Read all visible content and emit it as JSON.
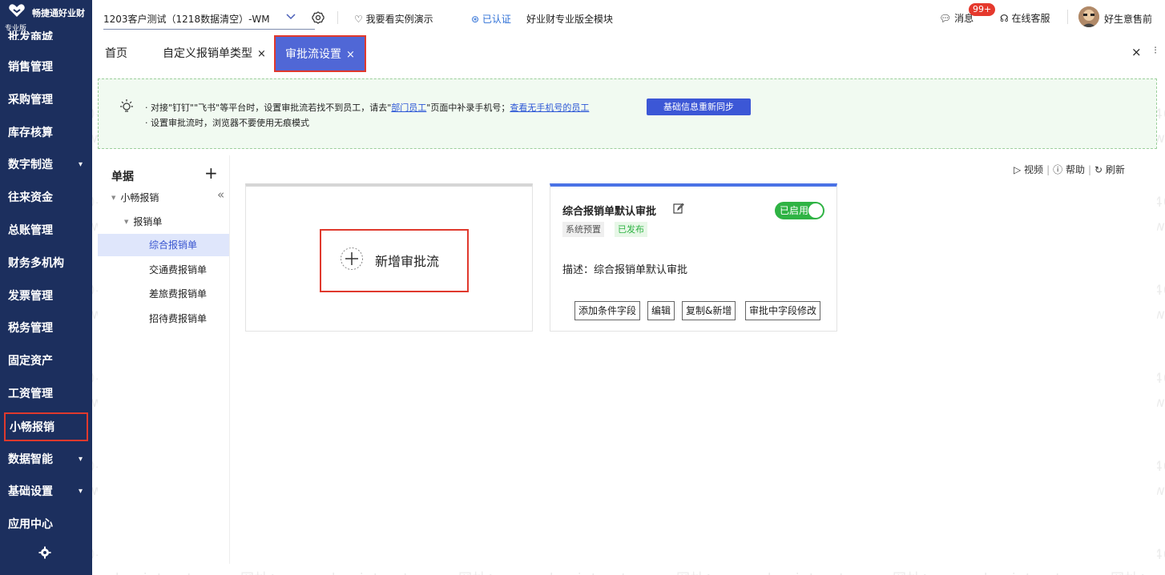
{
  "app": {
    "logo_name": "畅捷通好业财",
    "edition": "专业版",
    "partial_menu_item": "批发商城"
  },
  "sidebar": {
    "items": [
      {
        "label": "销售管理"
      },
      {
        "label": "采购管理"
      },
      {
        "label": "库存核算"
      },
      {
        "label": "数字制造",
        "arrow": "▾"
      },
      {
        "label": "往来资金"
      },
      {
        "label": "总账管理"
      },
      {
        "label": "财务多机构"
      },
      {
        "label": "发票管理"
      },
      {
        "label": "税务管理"
      },
      {
        "label": "固定资产"
      },
      {
        "label": "工资管理"
      },
      {
        "label": "小畅报销",
        "active": true
      },
      {
        "label": "数据智能",
        "arrow": "▾"
      },
      {
        "label": "基础设置",
        "arrow": "▾"
      },
      {
        "label": "应用中心"
      }
    ]
  },
  "header": {
    "company": "1203客户测试（1218数据清空）-WM",
    "demo": "我要看实例演示",
    "verified": "已认证",
    "package": "好业财专业版全模块",
    "messages": "消息",
    "message_badge": "99+",
    "customer_service": "在线客服",
    "user_name": "好生意售前"
  },
  "tabs": [
    {
      "label": "首页",
      "closable": false
    },
    {
      "label": "自定义报销单类型",
      "closable": true
    },
    {
      "label": "审批流设置",
      "closable": true,
      "active": true
    }
  ],
  "tab_close": "×",
  "banner": {
    "tip1_pre": "· 对接\"钉钉\"\"飞书\"等平台时，设置审批流若找不到员工，请去\"",
    "tip1_link": "部门员工",
    "tip1_mid": "\"页面中补录手机号；",
    "tip1_link2": "查看无手机号的员工",
    "sync_button": "基础信息重新同步",
    "tip2": "· 设置审批流时，浏览器不要使用无痕模式"
  },
  "tree": {
    "title": "单据",
    "add": "+",
    "collapse": "«",
    "root": "小畅报销",
    "group": "报销单",
    "leaves": [
      {
        "label": "综合报销单",
        "selected": true
      },
      {
        "label": "交通费报销单"
      },
      {
        "label": "差旅费报销单"
      },
      {
        "label": "招待费报销单"
      }
    ]
  },
  "toolbar": {
    "video": "视频",
    "help": "帮助",
    "refresh": "刷新"
  },
  "add_flow": {
    "label": "新增审批流"
  },
  "flow_card": {
    "title": "综合报销单默认审批",
    "status": "已启用",
    "tag_system": "系统预置",
    "tag_published": "已发布",
    "description": "描述：综合报销单默认审批",
    "buttons": [
      "添加条件字段",
      "编辑",
      "复制&新增",
      "审批中字段修改"
    ]
  },
  "watermark": {
    "phone": "电话：400-665-0028",
    "site": "网址：www.chanjet.net"
  },
  "colors": {
    "sidebar": "#1c2f5e",
    "accent": "#5067d6",
    "highlight_box": "#e0392d",
    "enabled_green": "#2fb344"
  }
}
